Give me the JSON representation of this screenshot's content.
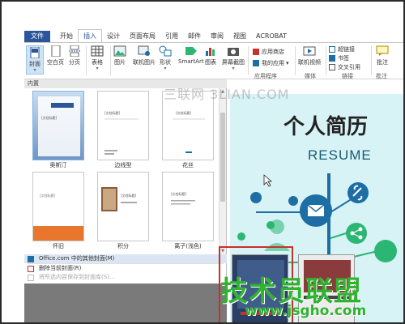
{
  "ribbon_tabs": [
    "文件",
    "开始",
    "插入",
    "设计",
    "页面布局",
    "引用",
    "邮件",
    "审阅",
    "视图",
    "ACROBAT"
  ],
  "ribbon": {
    "cover": "封面",
    "blank_page": "空白页",
    "page_break": "分页",
    "table": "表格",
    "picture": "图片",
    "online_picture": "联机图片",
    "shapes": "形状",
    "smartart": "SmartArt",
    "chart": "图表",
    "screenshot": "屏幕截图",
    "app_store": "应用商店",
    "my_apps": "我的应用",
    "apps_group": "应用程序",
    "online_video": "联机视频",
    "media_group": "媒体",
    "hyperlink": "超链接",
    "bookmark": "书签",
    "cross_ref": "交叉引用",
    "links_group": "链接",
    "comment": "批注"
  },
  "gallery": {
    "section_header": "内置",
    "items": [
      {
        "name": "奥斯汀",
        "placeholder": "[文档标题]"
      },
      {
        "name": "边线型",
        "placeholder": "[文档标题]"
      },
      {
        "name": "花丝",
        "placeholder": "[文档标题]"
      },
      {
        "name": "怀旧",
        "placeholder": "[文档标题]"
      },
      {
        "name": "积分",
        "placeholder": "[文档标题]"
      },
      {
        "name": "离子(浅色)",
        "placeholder": "[文档标题]"
      }
    ],
    "menu": [
      {
        "label": "Office.com 中的其他封面(M)",
        "state": "highlighted"
      },
      {
        "label": "删除当前封面(R)",
        "state": "normal"
      },
      {
        "label": "将所选内容保存到封面库(S)...",
        "state": "disabled"
      }
    ]
  },
  "document": {
    "title": "个人简历",
    "subtitle": "RESUME"
  },
  "watermarks": {
    "top": "三联网 3LIAN.COM",
    "bottom_cn": "技术员联盟",
    "bottom_url": "www.jsgho.com"
  },
  "colors": {
    "file_tab": "#2b579a",
    "doc_bg": "#d8f3f6",
    "icon_blue": "#1c6ea4",
    "icon_green": "#2bb673",
    "red_highlight": "#c9302c"
  }
}
